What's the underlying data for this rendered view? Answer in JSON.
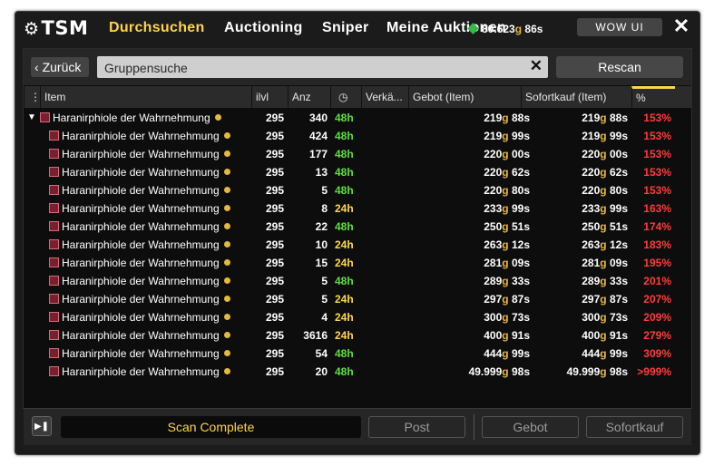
{
  "app": {
    "logo": "TSM"
  },
  "tabs": [
    "Durchsuchen",
    "Auctioning",
    "Sniper",
    "Meine Auktionen"
  ],
  "gold_readout": {
    "amount": "80.623",
    "unit": "g",
    "silver": "86s"
  },
  "wowui_label": "WOW UI",
  "search": {
    "back_label": "Zurück",
    "value": "Gruppensuche",
    "rescan_label": "Rescan"
  },
  "columns": {
    "item": "Item",
    "ilvl": "ilvl",
    "qty": "Anz",
    "seller": "Verkä...",
    "bid": "Gebot (Item)",
    "buyout": "Sofortkauf (Item)",
    "pct": "%"
  },
  "rows": [
    {
      "name": "Haranirphiole der Wahrnehmung",
      "ilvl": "295",
      "qty": "340",
      "time": "48h",
      "bid_g": "219",
      "bid_s": "88s",
      "buy_g": "219",
      "buy_s": "88s",
      "pct": "153%",
      "parent": true
    },
    {
      "name": "Haranirphiole der Wahrnehmung",
      "ilvl": "295",
      "qty": "424",
      "time": "48h",
      "bid_g": "219",
      "bid_s": "99s",
      "buy_g": "219",
      "buy_s": "99s",
      "pct": "153%"
    },
    {
      "name": "Haranirphiole der Wahrnehmung",
      "ilvl": "295",
      "qty": "177",
      "time": "48h",
      "bid_g": "220",
      "bid_s": "00s",
      "buy_g": "220",
      "buy_s": "00s",
      "pct": "153%"
    },
    {
      "name": "Haranirphiole der Wahrnehmung",
      "ilvl": "295",
      "qty": "13",
      "time": "48h",
      "bid_g": "220",
      "bid_s": "62s",
      "buy_g": "220",
      "buy_s": "62s",
      "pct": "153%"
    },
    {
      "name": "Haranirphiole der Wahrnehmung",
      "ilvl": "295",
      "qty": "5",
      "time": "48h",
      "bid_g": "220",
      "bid_s": "80s",
      "buy_g": "220",
      "buy_s": "80s",
      "pct": "153%"
    },
    {
      "name": "Haranirphiole der Wahrnehmung",
      "ilvl": "295",
      "qty": "8",
      "time": "24h",
      "bid_g": "233",
      "bid_s": "99s",
      "buy_g": "233",
      "buy_s": "99s",
      "pct": "163%"
    },
    {
      "name": "Haranirphiole der Wahrnehmung",
      "ilvl": "295",
      "qty": "22",
      "time": "48h",
      "bid_g": "250",
      "bid_s": "51s",
      "buy_g": "250",
      "buy_s": "51s",
      "pct": "174%"
    },
    {
      "name": "Haranirphiole der Wahrnehmung",
      "ilvl": "295",
      "qty": "10",
      "time": "24h",
      "bid_g": "263",
      "bid_s": "12s",
      "buy_g": "263",
      "buy_s": "12s",
      "pct": "183%"
    },
    {
      "name": "Haranirphiole der Wahrnehmung",
      "ilvl": "295",
      "qty": "15",
      "time": "24h",
      "bid_g": "281",
      "bid_s": "09s",
      "buy_g": "281",
      "buy_s": "09s",
      "pct": "195%"
    },
    {
      "name": "Haranirphiole der Wahrnehmung",
      "ilvl": "295",
      "qty": "5",
      "time": "48h",
      "bid_g": "289",
      "bid_s": "33s",
      "buy_g": "289",
      "buy_s": "33s",
      "pct": "201%"
    },
    {
      "name": "Haranirphiole der Wahrnehmung",
      "ilvl": "295",
      "qty": "5",
      "time": "24h",
      "bid_g": "297",
      "bid_s": "87s",
      "buy_g": "297",
      "buy_s": "87s",
      "pct": "207%"
    },
    {
      "name": "Haranirphiole der Wahrnehmung",
      "ilvl": "295",
      "qty": "4",
      "time": "24h",
      "bid_g": "300",
      "bid_s": "73s",
      "buy_g": "300",
      "buy_s": "73s",
      "pct": "209%"
    },
    {
      "name": "Haranirphiole der Wahrnehmung",
      "ilvl": "295",
      "qty": "3616",
      "time": "24h",
      "bid_g": "400",
      "bid_s": "91s",
      "buy_g": "400",
      "buy_s": "91s",
      "pct": "279%"
    },
    {
      "name": "Haranirphiole der Wahrnehmung",
      "ilvl": "295",
      "qty": "54",
      "time": "48h",
      "bid_g": "444",
      "bid_s": "99s",
      "buy_g": "444",
      "buy_s": "99s",
      "pct": "309%"
    },
    {
      "name": "Haranirphiole der Wahrnehmung",
      "ilvl": "295",
      "qty": "20",
      "time": "48h",
      "bid_g": "49.999",
      "bid_s": "98s",
      "buy_g": "49.999",
      "buy_s": "98s",
      "pct": ">999%"
    }
  ],
  "footer": {
    "status": "Scan Complete",
    "post_label": "Post",
    "bid_label": "Gebot",
    "buyout_label": "Sofortkauf"
  },
  "colors": {
    "accent": "#ffd54a",
    "gold": "#e6b73c",
    "time48": "#5fde3f",
    "time24": "#ffd84a",
    "pct": "#ff3c3c"
  }
}
